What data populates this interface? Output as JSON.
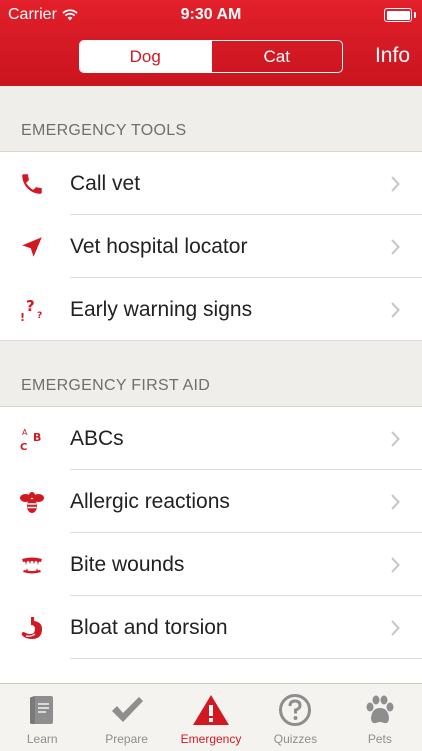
{
  "status_bar": {
    "carrier": "Carrier",
    "time": "9:30 AM"
  },
  "nav": {
    "segments": [
      {
        "label": "Dog",
        "selected": true
      },
      {
        "label": "Cat",
        "selected": false
      }
    ],
    "info_label": "Info"
  },
  "sections": [
    {
      "title": "EMERGENCY TOOLS",
      "items": [
        {
          "label": "Call vet",
          "icon": "phone-icon"
        },
        {
          "label": "Vet hospital locator",
          "icon": "location-arrow-icon"
        },
        {
          "label": "Early warning signs",
          "icon": "warning-signs-icon"
        }
      ]
    },
    {
      "title": "EMERGENCY FIRST AID",
      "items": [
        {
          "label": "ABCs",
          "icon": "abc-icon"
        },
        {
          "label": "Allergic reactions",
          "icon": "bee-icon"
        },
        {
          "label": "Bite wounds",
          "icon": "bite-icon"
        },
        {
          "label": "Bloat and torsion",
          "icon": "stomach-icon"
        }
      ]
    }
  ],
  "tabbar": {
    "tabs": [
      {
        "label": "Learn",
        "icon": "book-icon"
      },
      {
        "label": "Prepare",
        "icon": "checkmark-icon"
      },
      {
        "label": "Emergency",
        "icon": "warning-triangle-icon",
        "active": true
      },
      {
        "label": "Quizzes",
        "icon": "question-icon"
      },
      {
        "label": "Pets",
        "icon": "paw-icon"
      }
    ]
  },
  "colors": {
    "brand_red": "#d21921",
    "background": "#efeeeb",
    "tab_inactive": "#8e8e8e"
  }
}
